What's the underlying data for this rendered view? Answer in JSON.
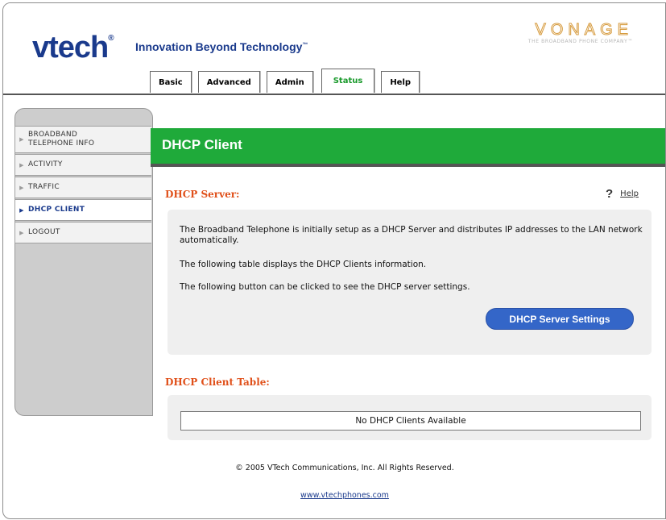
{
  "header": {
    "brand": "vtech",
    "tagline": "Innovation Beyond Technology",
    "tagline_mark": "™",
    "partner_name": "VONAGE",
    "partner_sub": "THE BROADBAND PHONE COMPANY™"
  },
  "tabs": [
    {
      "label": "Basic"
    },
    {
      "label": "Advanced"
    },
    {
      "label": "Admin"
    },
    {
      "label": "Status",
      "active": true
    },
    {
      "label": "Help"
    }
  ],
  "sidebar": {
    "items": [
      {
        "label": "BROADBAND TELEPHONE INFO"
      },
      {
        "label": "ACTIVITY"
      },
      {
        "label": "TRAFFIC"
      },
      {
        "label": "DHCP CLIENT",
        "active": true
      },
      {
        "label": "LOGOUT"
      }
    ]
  },
  "page": {
    "title": "DHCP Client",
    "help_label": "Help",
    "help_icon": "?"
  },
  "server_section": {
    "title": "DHCP Server:",
    "text1": "The Broadband Telephone is initially setup as a DHCP Server and distributes IP addresses to the LAN network automatically.",
    "text2": "The following table displays the DHCP Clients information.",
    "text3": "The following button can be clicked to see the DHCP server settings.",
    "button_label": "DHCP Server Settings"
  },
  "client_table": {
    "title": "DHCP Client Table:",
    "empty_text": "No DHCP Clients Available"
  },
  "footer": {
    "copyright": "© 2005 VTech Communications, Inc. All Rights Reserved.",
    "link": "www.vtechphones.com"
  },
  "colors": {
    "accent_green": "#1faa3a",
    "section_orange": "#e0501a",
    "button_blue": "#3466c8",
    "brand_blue": "#1a3a8c"
  }
}
